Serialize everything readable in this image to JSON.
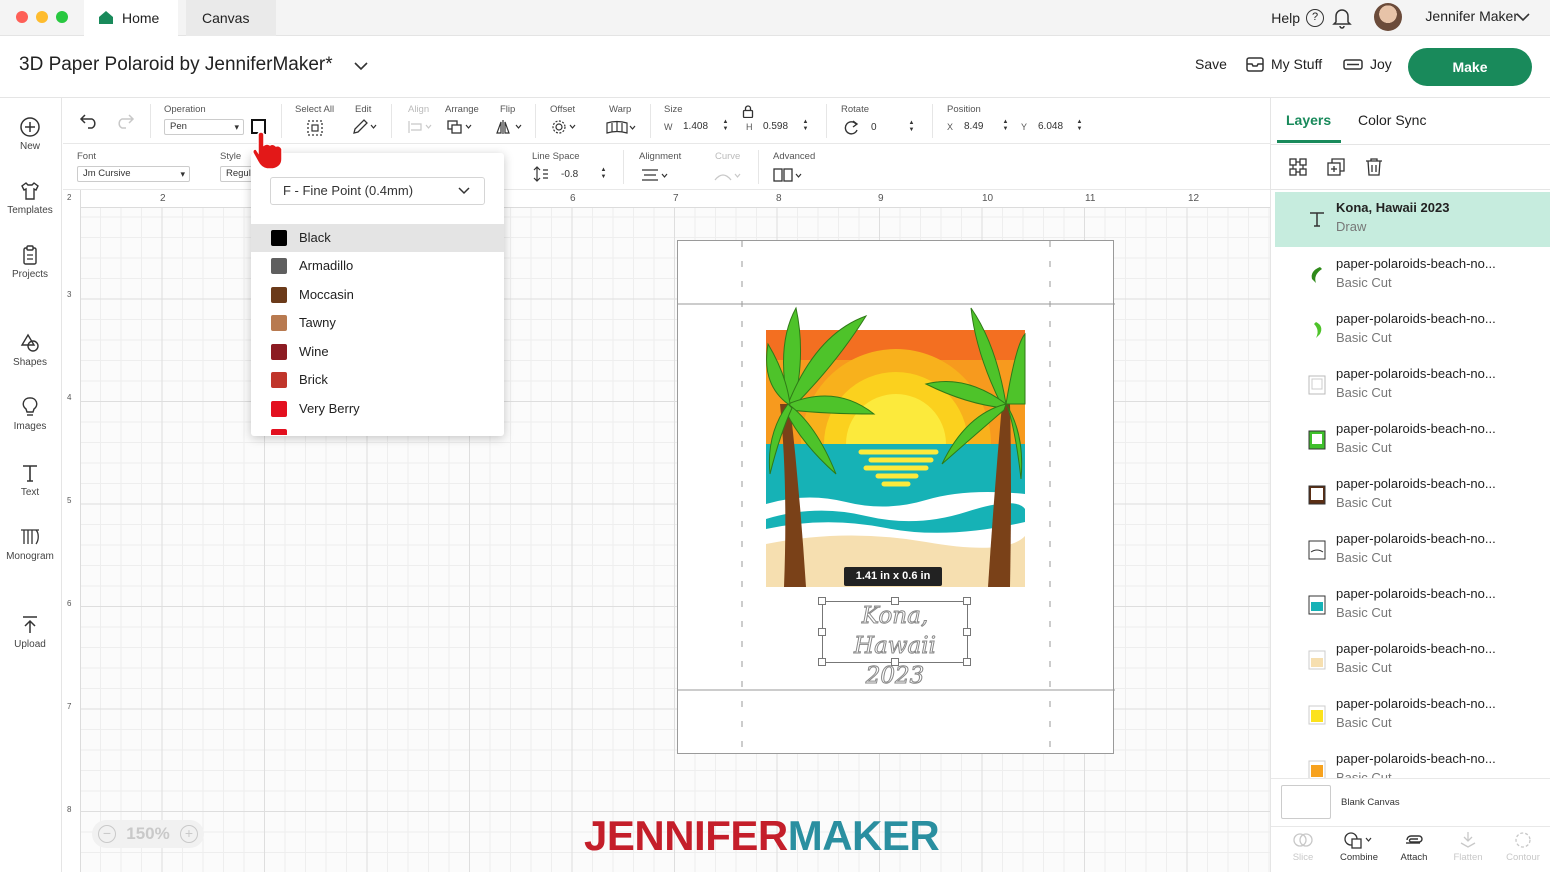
{
  "titlebar": {
    "tabs": [
      {
        "label": "Home"
      },
      {
        "label": "Canvas"
      }
    ],
    "help_label": "Help",
    "user_name": "Jennifer Maker"
  },
  "header": {
    "project_title": "3D Paper Polaroid by JenniferMaker*",
    "save_label": "Save",
    "my_stuff_label": "My Stuff",
    "machine_label": "Joy",
    "make_label": "Make"
  },
  "left_nav": [
    {
      "label": "New",
      "icon": "plus-circle-icon"
    },
    {
      "label": "Templates",
      "icon": "shirt-icon"
    },
    {
      "label": "Projects",
      "icon": "clipboard-icon"
    },
    {
      "label": "Shapes",
      "icon": "shapes-icon"
    },
    {
      "label": "Images",
      "icon": "lightbulb-icon"
    },
    {
      "label": "Text",
      "icon": "text-icon"
    },
    {
      "label": "Monogram",
      "icon": "monogram-icon"
    },
    {
      "label": "Upload",
      "icon": "upload-icon"
    }
  ],
  "toolbar1": {
    "operation_label": "Operation",
    "operation_value": "Pen",
    "select_all_label": "Select All",
    "edit_label": "Edit",
    "align_label": "Align",
    "arrange_label": "Arrange",
    "flip_label": "Flip",
    "offset_label": "Offset",
    "warp_label": "Warp",
    "size_label": "Size",
    "w_label": "W",
    "w_value": "1.408",
    "h_label": "H",
    "h_value": "0.598",
    "rotate_label": "Rotate",
    "rotate_value": "0",
    "position_label": "Position",
    "x_label": "X",
    "x_value": "8.49",
    "y_label": "Y",
    "y_value": "6.048"
  },
  "toolbar2": {
    "font_label": "Font",
    "font_value": "Jm Cursive",
    "style_label": "Style",
    "style_value": "Regul",
    "line_space_label": "Line Space",
    "line_space_value": "-0.8",
    "alignment_label": "Alignment",
    "curve_label": "Curve",
    "advanced_label": "Advanced"
  },
  "ruler": {
    "h_ticks": [
      "2",
      "6",
      "7",
      "8",
      "9",
      "10",
      "11",
      "12"
    ],
    "v_ticks": [
      "2",
      "3",
      "4",
      "5",
      "6",
      "7",
      "8"
    ]
  },
  "pen_dropdown": {
    "pen_type": "F - Fine Point (0.4mm)",
    "colors": [
      {
        "name": "Black",
        "hex": "#000000",
        "selected": true
      },
      {
        "name": "Armadillo",
        "hex": "#5f5f5f",
        "selected": false
      },
      {
        "name": "Moccasin",
        "hex": "#6b3a1a",
        "selected": false
      },
      {
        "name": "Tawny",
        "hex": "#b87a50",
        "selected": false
      },
      {
        "name": "Wine",
        "hex": "#8c1b22",
        "selected": false
      },
      {
        "name": "Brick",
        "hex": "#c0352b",
        "selected": false
      },
      {
        "name": "Very Berry",
        "hex": "#e3101f",
        "selected": false
      }
    ]
  },
  "canvas": {
    "dimension_tag": "1.41  in x 0.6  in",
    "text_line1": "Kona, Hawaii",
    "text_line2": "2023",
    "zoom_value": "150%",
    "watermark_part1": "JENNIFER",
    "watermark_part2": "MAKER"
  },
  "right_panel": {
    "tab_layers": "Layers",
    "tab_color_sync": "Color Sync",
    "layers": [
      {
        "name": "Kona, Hawaii 2023",
        "op": "Draw",
        "thumb": "text",
        "selected": true
      },
      {
        "name": "paper-polaroids-beach-no...",
        "op": "Basic Cut",
        "thumb": "palm-dark",
        "selected": false
      },
      {
        "name": "paper-polaroids-beach-no...",
        "op": "Basic Cut",
        "thumb": "palm-light",
        "selected": false
      },
      {
        "name": "paper-polaroids-beach-no...",
        "op": "Basic Cut",
        "thumb": "frame-white",
        "selected": false
      },
      {
        "name": "paper-polaroids-beach-no...",
        "op": "Basic Cut",
        "thumb": "frame-green",
        "selected": false
      },
      {
        "name": "paper-polaroids-beach-no...",
        "op": "Basic Cut",
        "thumb": "frame-brown",
        "selected": false
      },
      {
        "name": "paper-polaroids-beach-no...",
        "op": "Basic Cut",
        "thumb": "frame-wave",
        "selected": false
      },
      {
        "name": "paper-polaroids-beach-no...",
        "op": "Basic Cut",
        "thumb": "frame-teal",
        "selected": false
      },
      {
        "name": "paper-polaroids-beach-no...",
        "op": "Basic Cut",
        "thumb": "frame-sand",
        "selected": false
      },
      {
        "name": "paper-polaroids-beach-no...",
        "op": "Basic Cut",
        "thumb": "frame-yellow",
        "selected": false
      },
      {
        "name": "paper-polaroids-beach-no...",
        "op": "Basic Cut",
        "thumb": "frame-orange",
        "selected": false
      }
    ],
    "blank_canvas_label": "Blank Canvas",
    "bottom_tools": [
      {
        "label": "Slice",
        "disabled": true
      },
      {
        "label": "Combine",
        "disabled": false
      },
      {
        "label": "Attach",
        "disabled": false
      },
      {
        "label": "Flatten",
        "disabled": true
      },
      {
        "label": "Contour",
        "disabled": true
      }
    ]
  },
  "colors": {
    "accent": "#198a5b",
    "layer_selected_bg": "#c6ecde",
    "watermark_red": "#c41e2a",
    "watermark_teal": "#2a8fa0"
  }
}
